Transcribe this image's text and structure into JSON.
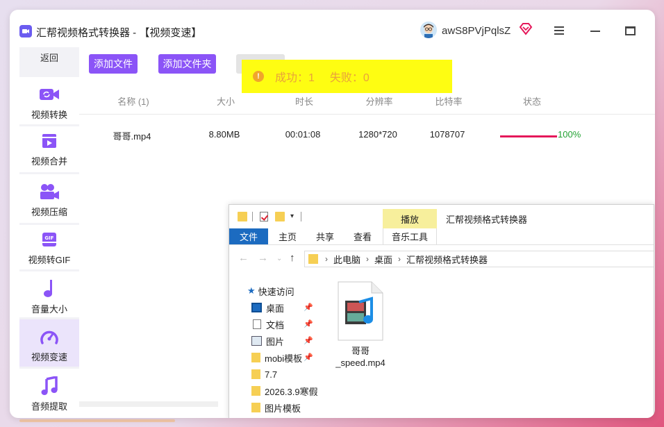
{
  "window": {
    "app_title": "汇帮视频格式转换器",
    "page_title": " - 【视频变速】",
    "username": "awS8PVjPqlsZ"
  },
  "sidebar": {
    "back_label": "返回",
    "items": [
      {
        "label": "视频转换",
        "icon": "video-convert-icon"
      },
      {
        "label": "视频合并",
        "icon": "video-merge-icon"
      },
      {
        "label": "视频压缩",
        "icon": "video-compress-icon"
      },
      {
        "label": "视频转GIF",
        "icon": "gif-icon"
      },
      {
        "label": "音量大小",
        "icon": "music-note-icon"
      },
      {
        "label": "视频变速",
        "icon": "speedometer-icon"
      },
      {
        "label": "音频提取",
        "icon": "audio-extract-icon"
      }
    ]
  },
  "toolbar": {
    "add_file": "添加文件",
    "add_folder": "添加文件夹"
  },
  "toast": {
    "success": "成功：1",
    "fail": "失败：0"
  },
  "table": {
    "headers": [
      "名称 (1)",
      "大小",
      "时长",
      "分辨率",
      "比特率",
      "状态"
    ],
    "rows": [
      {
        "name": "哥哥.mp4",
        "size": "8.80MB",
        "duration": "00:01:08",
        "resolution": "1280*720",
        "bitrate": "1078707",
        "progress_pct": 100,
        "status": "100%"
      }
    ]
  },
  "explorer": {
    "title": "汇帮视频格式转换器",
    "play_tab": "播放",
    "ribbon_tabs": [
      "文件",
      "主页",
      "共享",
      "查看",
      "音乐工具"
    ],
    "breadcrumb": [
      "此电脑",
      "桌面",
      "汇帮视频格式转换器"
    ],
    "nav_items": [
      {
        "label": "快速访问"
      },
      {
        "label": "桌面"
      },
      {
        "label": "文档"
      },
      {
        "label": "图片"
      },
      {
        "label": "mobi模板"
      },
      {
        "label": "7.7"
      },
      {
        "label": "2026.3.9寒假"
      },
      {
        "label": "图片模板"
      }
    ],
    "file": {
      "line1": "哥哥",
      "line2": "_speed.mp4"
    }
  },
  "colors": {
    "accent": "#8b54f7",
    "progress": "#e5185a",
    "success_text": "#22a233",
    "toast_bg": "#fefd12"
  }
}
